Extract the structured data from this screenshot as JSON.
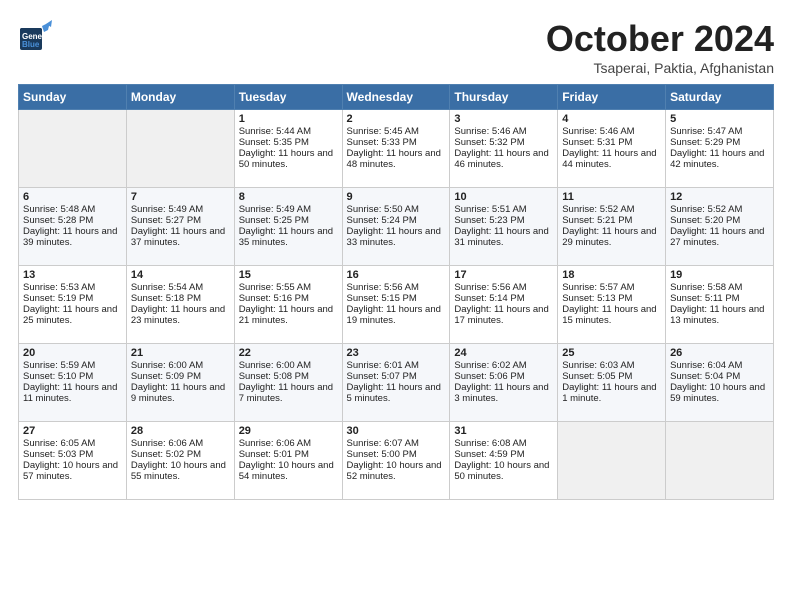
{
  "header": {
    "logo_general": "General",
    "logo_blue": "Blue",
    "title": "October 2024",
    "location": "Tsaperai, Paktia, Afghanistan"
  },
  "days_of_week": [
    "Sunday",
    "Monday",
    "Tuesday",
    "Wednesday",
    "Thursday",
    "Friday",
    "Saturday"
  ],
  "weeks": [
    [
      {
        "day": "",
        "sunrise": "",
        "sunset": "",
        "daylight": ""
      },
      {
        "day": "",
        "sunrise": "",
        "sunset": "",
        "daylight": ""
      },
      {
        "day": "1",
        "sunrise": "Sunrise: 5:44 AM",
        "sunset": "Sunset: 5:35 PM",
        "daylight": "Daylight: 11 hours and 50 minutes."
      },
      {
        "day": "2",
        "sunrise": "Sunrise: 5:45 AM",
        "sunset": "Sunset: 5:33 PM",
        "daylight": "Daylight: 11 hours and 48 minutes."
      },
      {
        "day": "3",
        "sunrise": "Sunrise: 5:46 AM",
        "sunset": "Sunset: 5:32 PM",
        "daylight": "Daylight: 11 hours and 46 minutes."
      },
      {
        "day": "4",
        "sunrise": "Sunrise: 5:46 AM",
        "sunset": "Sunset: 5:31 PM",
        "daylight": "Daylight: 11 hours and 44 minutes."
      },
      {
        "day": "5",
        "sunrise": "Sunrise: 5:47 AM",
        "sunset": "Sunset: 5:29 PM",
        "daylight": "Daylight: 11 hours and 42 minutes."
      }
    ],
    [
      {
        "day": "6",
        "sunrise": "Sunrise: 5:48 AM",
        "sunset": "Sunset: 5:28 PM",
        "daylight": "Daylight: 11 hours and 39 minutes."
      },
      {
        "day": "7",
        "sunrise": "Sunrise: 5:49 AM",
        "sunset": "Sunset: 5:27 PM",
        "daylight": "Daylight: 11 hours and 37 minutes."
      },
      {
        "day": "8",
        "sunrise": "Sunrise: 5:49 AM",
        "sunset": "Sunset: 5:25 PM",
        "daylight": "Daylight: 11 hours and 35 minutes."
      },
      {
        "day": "9",
        "sunrise": "Sunrise: 5:50 AM",
        "sunset": "Sunset: 5:24 PM",
        "daylight": "Daylight: 11 hours and 33 minutes."
      },
      {
        "day": "10",
        "sunrise": "Sunrise: 5:51 AM",
        "sunset": "Sunset: 5:23 PM",
        "daylight": "Daylight: 11 hours and 31 minutes."
      },
      {
        "day": "11",
        "sunrise": "Sunrise: 5:52 AM",
        "sunset": "Sunset: 5:21 PM",
        "daylight": "Daylight: 11 hours and 29 minutes."
      },
      {
        "day": "12",
        "sunrise": "Sunrise: 5:52 AM",
        "sunset": "Sunset: 5:20 PM",
        "daylight": "Daylight: 11 hours and 27 minutes."
      }
    ],
    [
      {
        "day": "13",
        "sunrise": "Sunrise: 5:53 AM",
        "sunset": "Sunset: 5:19 PM",
        "daylight": "Daylight: 11 hours and 25 minutes."
      },
      {
        "day": "14",
        "sunrise": "Sunrise: 5:54 AM",
        "sunset": "Sunset: 5:18 PM",
        "daylight": "Daylight: 11 hours and 23 minutes."
      },
      {
        "day": "15",
        "sunrise": "Sunrise: 5:55 AM",
        "sunset": "Sunset: 5:16 PM",
        "daylight": "Daylight: 11 hours and 21 minutes."
      },
      {
        "day": "16",
        "sunrise": "Sunrise: 5:56 AM",
        "sunset": "Sunset: 5:15 PM",
        "daylight": "Daylight: 11 hours and 19 minutes."
      },
      {
        "day": "17",
        "sunrise": "Sunrise: 5:56 AM",
        "sunset": "Sunset: 5:14 PM",
        "daylight": "Daylight: 11 hours and 17 minutes."
      },
      {
        "day": "18",
        "sunrise": "Sunrise: 5:57 AM",
        "sunset": "Sunset: 5:13 PM",
        "daylight": "Daylight: 11 hours and 15 minutes."
      },
      {
        "day": "19",
        "sunrise": "Sunrise: 5:58 AM",
        "sunset": "Sunset: 5:11 PM",
        "daylight": "Daylight: 11 hours and 13 minutes."
      }
    ],
    [
      {
        "day": "20",
        "sunrise": "Sunrise: 5:59 AM",
        "sunset": "Sunset: 5:10 PM",
        "daylight": "Daylight: 11 hours and 11 minutes."
      },
      {
        "day": "21",
        "sunrise": "Sunrise: 6:00 AM",
        "sunset": "Sunset: 5:09 PM",
        "daylight": "Daylight: 11 hours and 9 minutes."
      },
      {
        "day": "22",
        "sunrise": "Sunrise: 6:00 AM",
        "sunset": "Sunset: 5:08 PM",
        "daylight": "Daylight: 11 hours and 7 minutes."
      },
      {
        "day": "23",
        "sunrise": "Sunrise: 6:01 AM",
        "sunset": "Sunset: 5:07 PM",
        "daylight": "Daylight: 11 hours and 5 minutes."
      },
      {
        "day": "24",
        "sunrise": "Sunrise: 6:02 AM",
        "sunset": "Sunset: 5:06 PM",
        "daylight": "Daylight: 11 hours and 3 minutes."
      },
      {
        "day": "25",
        "sunrise": "Sunrise: 6:03 AM",
        "sunset": "Sunset: 5:05 PM",
        "daylight": "Daylight: 11 hours and 1 minute."
      },
      {
        "day": "26",
        "sunrise": "Sunrise: 6:04 AM",
        "sunset": "Sunset: 5:04 PM",
        "daylight": "Daylight: 10 hours and 59 minutes."
      }
    ],
    [
      {
        "day": "27",
        "sunrise": "Sunrise: 6:05 AM",
        "sunset": "Sunset: 5:03 PM",
        "daylight": "Daylight: 10 hours and 57 minutes."
      },
      {
        "day": "28",
        "sunrise": "Sunrise: 6:06 AM",
        "sunset": "Sunset: 5:02 PM",
        "daylight": "Daylight: 10 hours and 55 minutes."
      },
      {
        "day": "29",
        "sunrise": "Sunrise: 6:06 AM",
        "sunset": "Sunset: 5:01 PM",
        "daylight": "Daylight: 10 hours and 54 minutes."
      },
      {
        "day": "30",
        "sunrise": "Sunrise: 6:07 AM",
        "sunset": "Sunset: 5:00 PM",
        "daylight": "Daylight: 10 hours and 52 minutes."
      },
      {
        "day": "31",
        "sunrise": "Sunrise: 6:08 AM",
        "sunset": "Sunset: 4:59 PM",
        "daylight": "Daylight: 10 hours and 50 minutes."
      },
      {
        "day": "",
        "sunrise": "",
        "sunset": "",
        "daylight": ""
      },
      {
        "day": "",
        "sunrise": "",
        "sunset": "",
        "daylight": ""
      }
    ]
  ]
}
